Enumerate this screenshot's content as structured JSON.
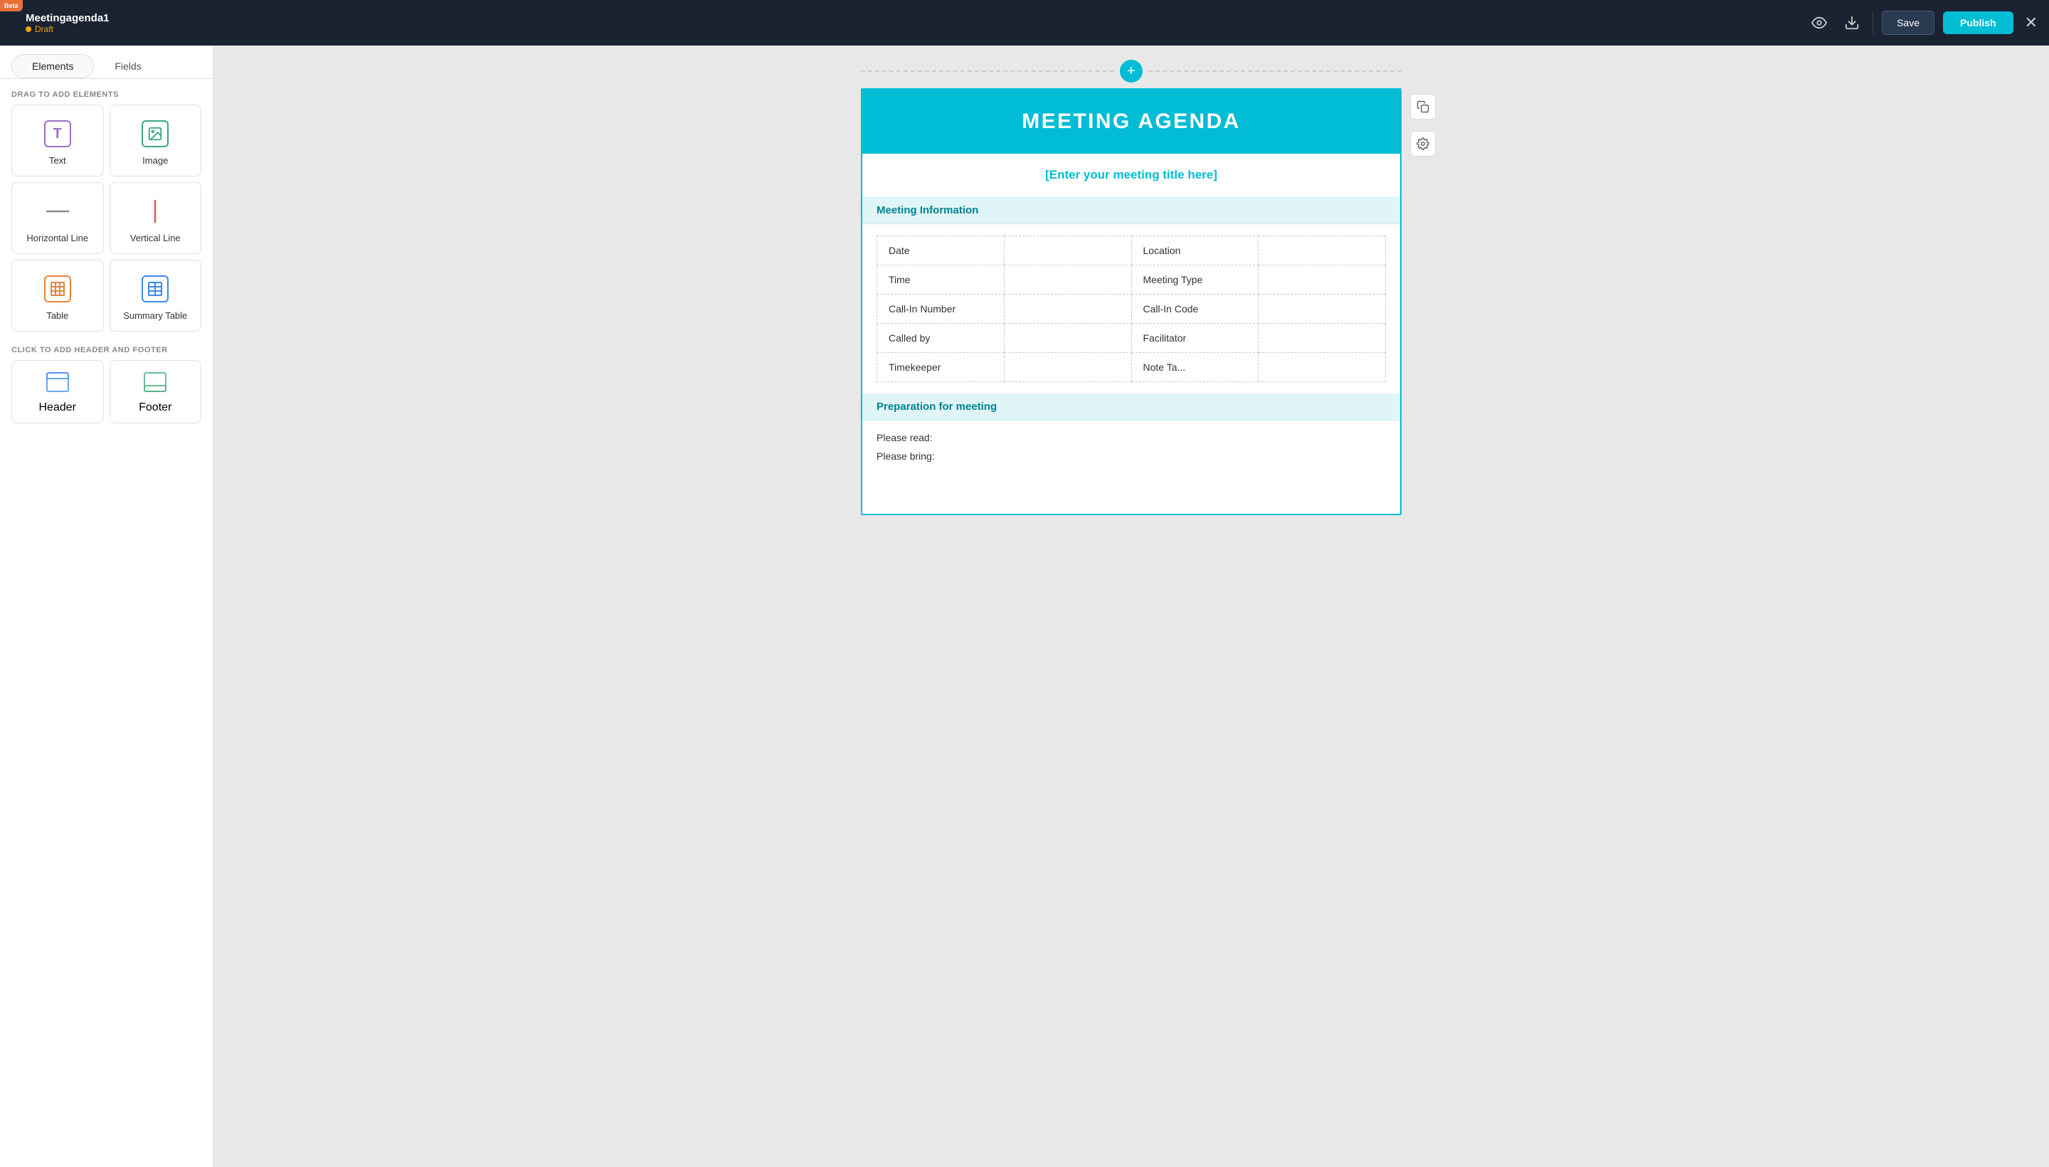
{
  "topbar": {
    "beta_label": "Beta",
    "title": "Meetingagenda1",
    "status": "Draft",
    "save_label": "Save",
    "publish_label": "Publish"
  },
  "sidebar": {
    "tab_elements": "Elements",
    "tab_fields": "Fields",
    "drag_section_label": "DRAG TO ADD ELEMENTS",
    "click_section_label": "CLICK TO ADD HEADER AND FOOTER",
    "elements": [
      {
        "id": "text",
        "label": "Text",
        "icon": "text"
      },
      {
        "id": "image",
        "label": "Image",
        "icon": "image"
      },
      {
        "id": "horizontal-line",
        "label": "Horizontal Line",
        "icon": "hline"
      },
      {
        "id": "vertical-line",
        "label": "Vertical Line",
        "icon": "vline"
      },
      {
        "id": "table",
        "label": "Table",
        "icon": "table"
      },
      {
        "id": "summary-table",
        "label": "Summary Table",
        "icon": "summary"
      }
    ],
    "footer_elements": [
      {
        "id": "header",
        "label": "Header"
      },
      {
        "id": "footer",
        "label": "Footer"
      }
    ]
  },
  "document": {
    "banner_title": "MEETING AGENDA",
    "meeting_title_placeholder": "[Enter your meeting title here]",
    "sections": [
      {
        "id": "meeting-info",
        "title": "Meeting Information",
        "table_rows": [
          {
            "left_label": "Date",
            "left_value": "",
            "right_label": "Location",
            "right_value": ""
          },
          {
            "left_label": "Time",
            "left_value": "",
            "right_label": "Meeting Type",
            "right_value": ""
          },
          {
            "left_label": "Call-In Number",
            "left_value": "",
            "right_label": "Call-In Code",
            "right_value": ""
          },
          {
            "left_label": "Called by",
            "left_value": "",
            "right_label": "Facilitator",
            "right_value": ""
          },
          {
            "left_label": "Timekeeper",
            "left_value": "",
            "right_label": "Note Ta...",
            "right_value": ""
          }
        ]
      },
      {
        "id": "preparation",
        "title": "Preparation for meeting",
        "items": [
          "Please read:",
          "Please bring:"
        ]
      }
    ]
  }
}
